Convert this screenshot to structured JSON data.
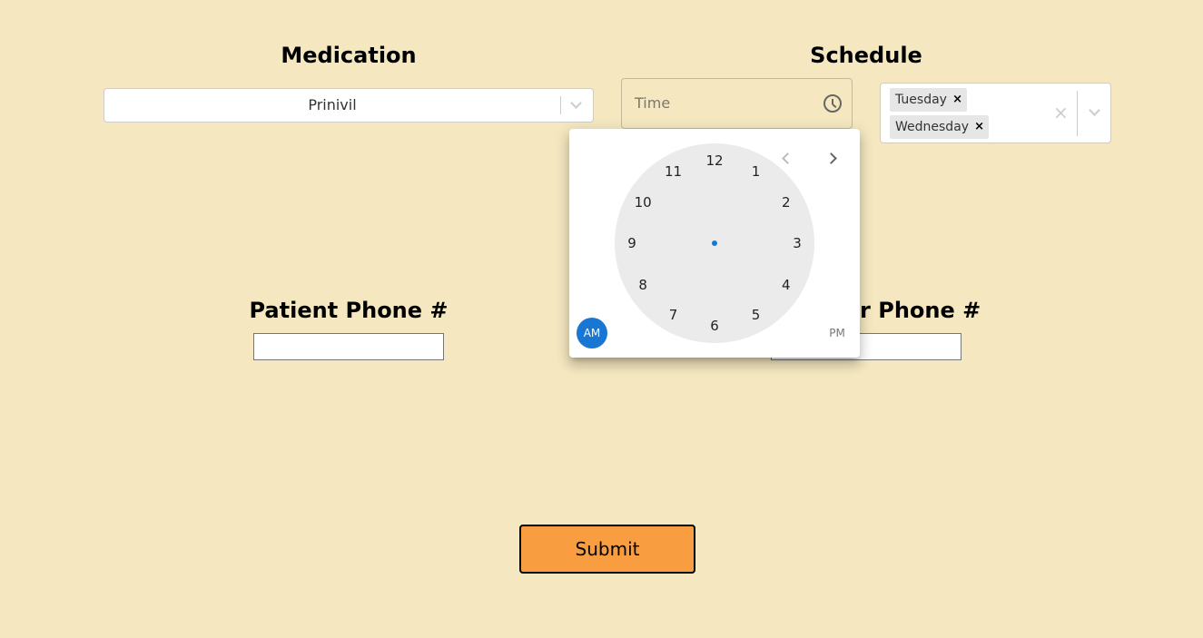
{
  "medication": {
    "heading": "Medication",
    "selected": "Prinivil"
  },
  "schedule": {
    "heading": "Schedule",
    "time_placeholder": "Time",
    "days": [
      "Tuesday",
      "Wednesday"
    ],
    "chip_remove": "×",
    "clear_all": "×"
  },
  "clock_picker": {
    "hours": [
      "12",
      "1",
      "2",
      "3",
      "4",
      "5",
      "6",
      "7",
      "8",
      "9",
      "10",
      "11"
    ],
    "am_label": "AM",
    "pm_label": "PM",
    "selected_period": "AM",
    "accent_color": "#1976d2"
  },
  "patient_phone": {
    "heading": "Patient Phone #",
    "value": ""
  },
  "caregiver_phone": {
    "heading": "Caregiver Phone #",
    "value": ""
  },
  "submit_label": "Submit",
  "colors": {
    "background": "#f5e8c0",
    "submit": "#f89e40"
  }
}
